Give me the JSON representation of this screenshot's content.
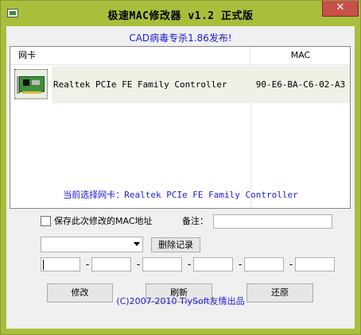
{
  "window": {
    "title": "极速MAC修改器 v1.2 正式版",
    "close_label": "✕",
    "title_bar_color": "#a9bf3c"
  },
  "notice": "CAD病毒专杀1.86发布!",
  "adapter_list": {
    "columns": [
      "网卡",
      "MAC"
    ],
    "rows": [
      {
        "name": "Realtek PCIe FE Family Controller",
        "mac": "90-E6-BA-C6-02-A3",
        "icon": "network-card-icon"
      }
    ]
  },
  "current_selection": "当前选择网卡：Realtek PCIe FE Family Controller",
  "save_checkbox": {
    "label": "保存此次修改的MAC地址",
    "checked": false
  },
  "remark": {
    "label": "备注：",
    "value": ""
  },
  "history_combo": {
    "value": ""
  },
  "buttons": {
    "delete": "删除记录",
    "modify": "修改",
    "refresh": "刷新",
    "restore": "还原"
  },
  "mac_fields": [
    "",
    "",
    "",
    "",
    "",
    ""
  ],
  "mac_separator": "-",
  "footer": "(C)2007-2010 TiySoft友情出品"
}
